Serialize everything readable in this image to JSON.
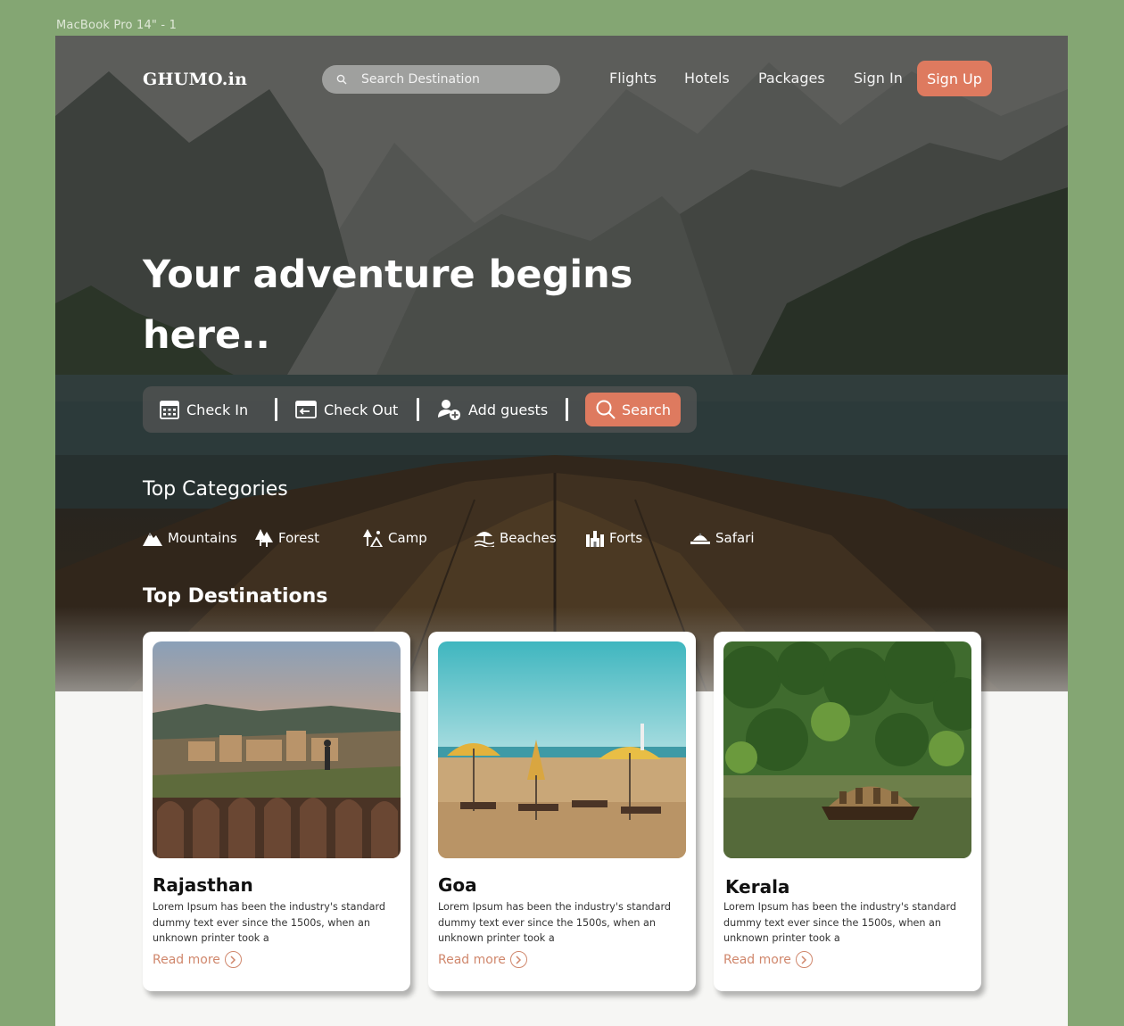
{
  "frame_label": "MacBook Pro 14\" - 1",
  "header": {
    "logo": "GHUMO.in",
    "search_placeholder": "Search Destination",
    "nav": [
      "Flights",
      "Hotels",
      "Packages",
      "Sign In"
    ],
    "signup_label": "Sign Up"
  },
  "hero": {
    "headline_line1": "Your adventure begins",
    "headline_line2": "here.."
  },
  "booking": {
    "check_in": "Check In",
    "check_out": "Check Out",
    "add_guests": "Add guests",
    "search": "Search"
  },
  "categories": {
    "title": "Top Categories",
    "items": [
      {
        "label": "Mountains",
        "icon": "mountain-icon"
      },
      {
        "label": "Forest",
        "icon": "tree-icon"
      },
      {
        "label": "Camp",
        "icon": "camp-icon"
      },
      {
        "label": "Beaches",
        "icon": "beach-icon"
      },
      {
        "label": "Forts",
        "icon": "fort-icon"
      },
      {
        "label": "Safari",
        "icon": "safari-icon"
      }
    ]
  },
  "destinations": {
    "title": "Top Destinations",
    "cards": [
      {
        "name": "Rajasthan",
        "desc": "Lorem Ipsum has been the industry's standard dummy text ever since the 1500s, when an unknown printer took a",
        "more": "Read more"
      },
      {
        "name": "Goa",
        "desc": "Lorem Ipsum has been the industry's standard dummy text ever since the 1500s, when an unknown printer took a",
        "more": "Read more"
      },
      {
        "name": "Kerala",
        "desc": "Lorem Ipsum has been the industry's standard dummy text ever since the 1500s, when an unknown printer took a",
        "more": "Read more"
      }
    ]
  },
  "colors": {
    "accent": "#de7a5f",
    "link": "#d0876c",
    "canvas": "#84a673"
  }
}
